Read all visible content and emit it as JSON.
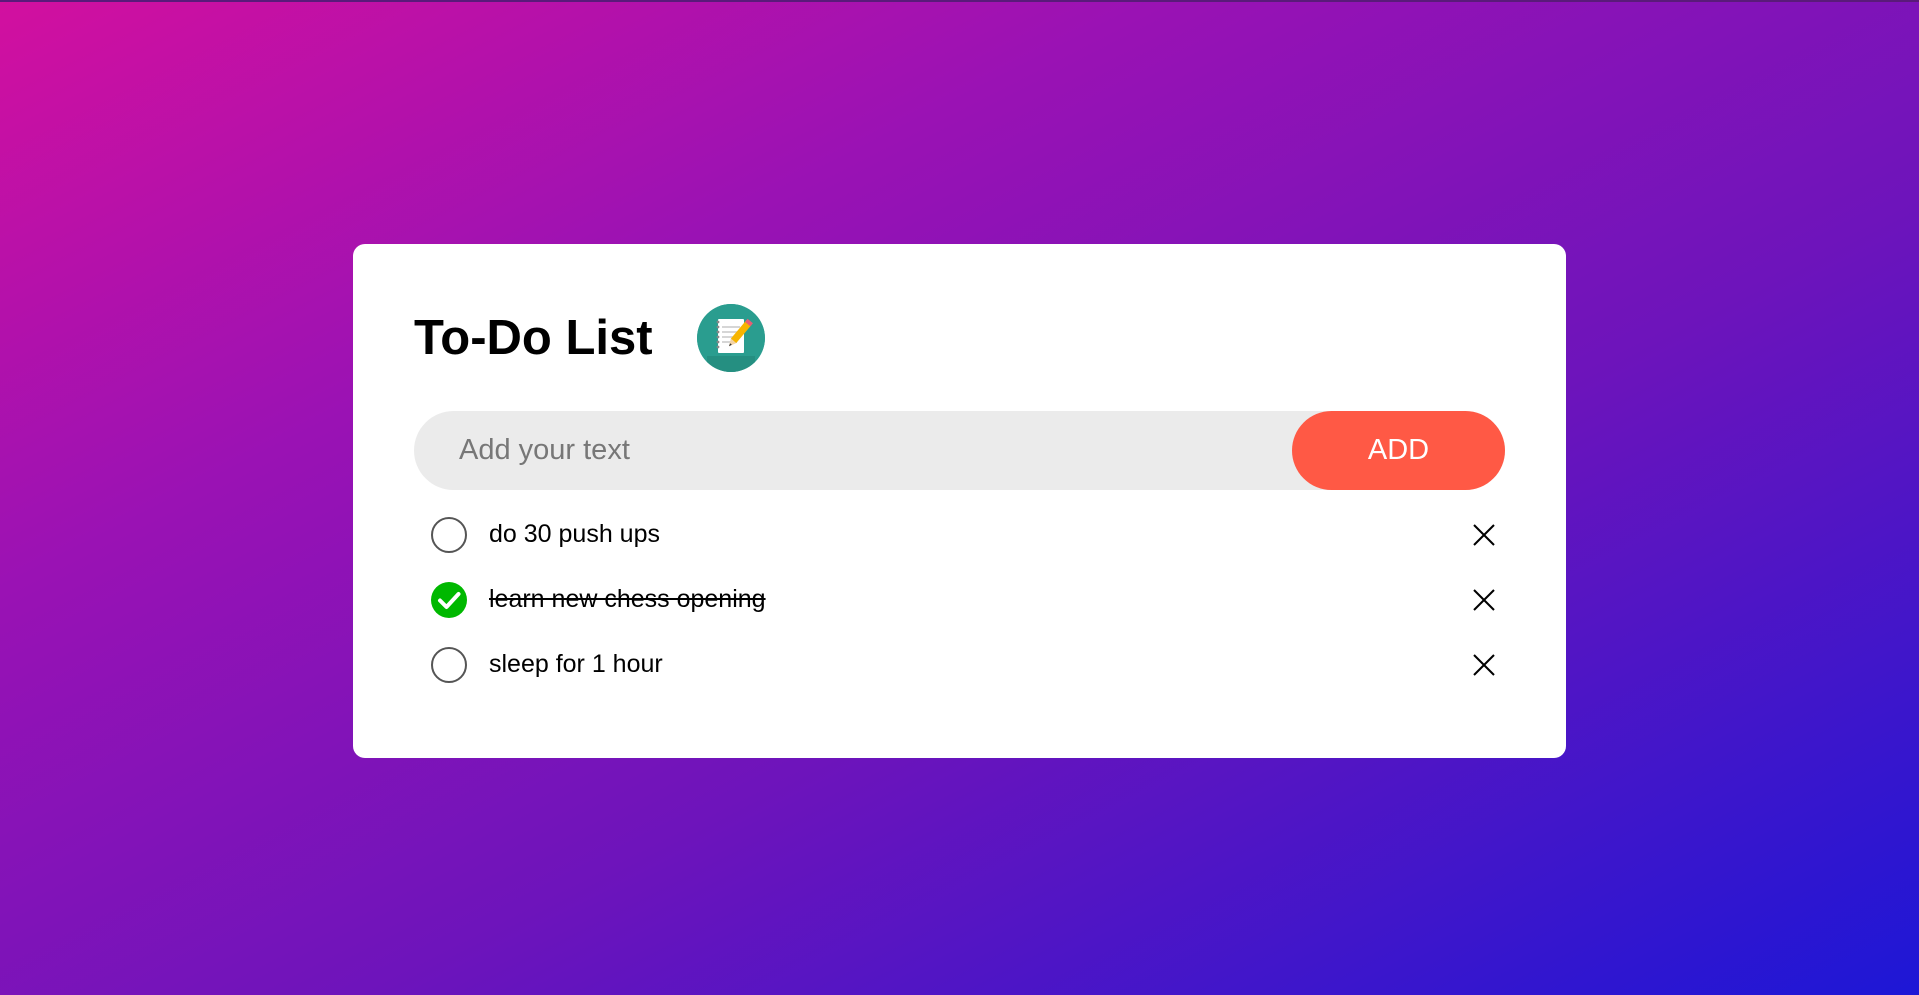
{
  "app": {
    "title": "To-Do List",
    "icon": "notebook-pencil-icon"
  },
  "input": {
    "value": "",
    "placeholder": "Add your text"
  },
  "add_button": {
    "label": "ADD"
  },
  "tasks": [
    {
      "text": "do 30 push ups",
      "done": false
    },
    {
      "text": "learn new chess opening",
      "done": true
    },
    {
      "text": "sleep for 1 hour",
      "done": false
    }
  ],
  "colors": {
    "background_start": "#d2109f",
    "background_end": "#1d17d6",
    "card": "#ffffff",
    "accent": "#ff5945",
    "check_done": "#00b800",
    "input_bg": "#ebebeb"
  }
}
